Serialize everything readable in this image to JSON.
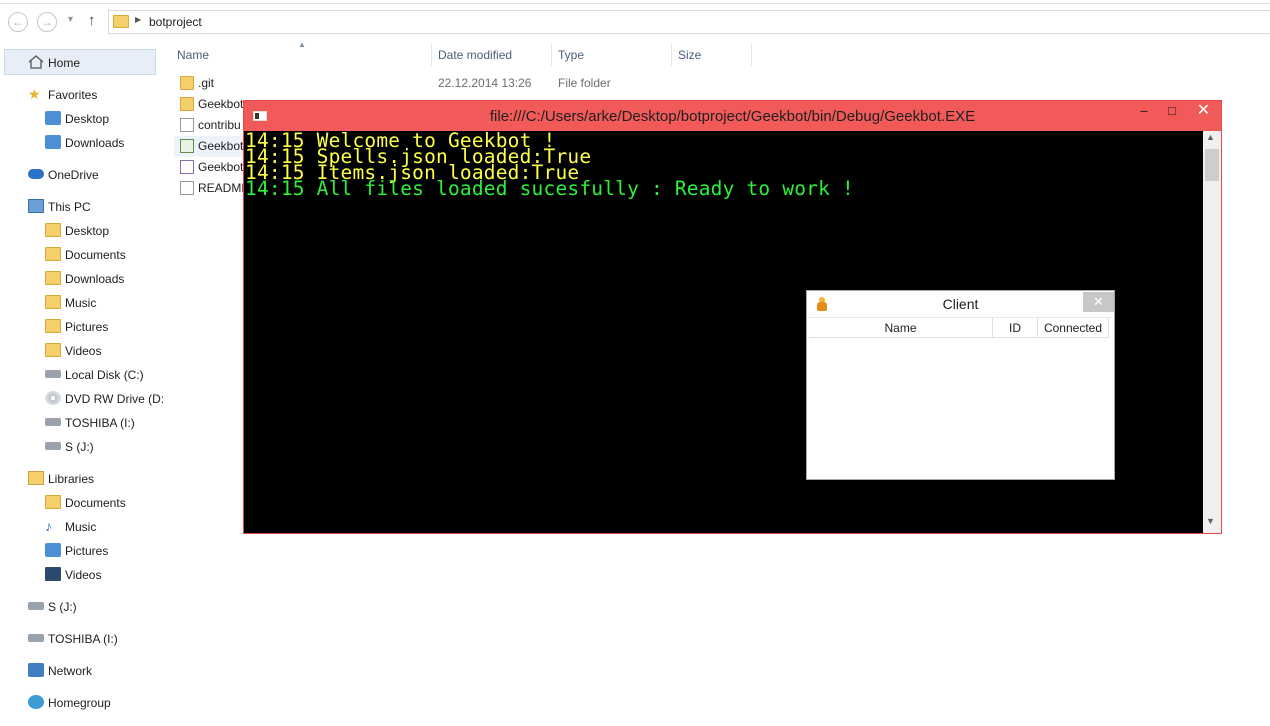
{
  "explorer": {
    "breadcrumb": "botproject",
    "columns": {
      "name": "Name",
      "date_modified": "Date modified",
      "type": "Type",
      "size": "Size"
    },
    "files": [
      {
        "name": ".git",
        "date": "22.12.2014 13:26",
        "type": "File folder",
        "icon": "folder-icon"
      },
      {
        "name": "Geekbot",
        "date": "",
        "type": "",
        "icon": "folder-icon"
      },
      {
        "name": "contribu",
        "date": "",
        "type": "",
        "icon": "file-icon"
      },
      {
        "name": "Geekbot",
        "date": "",
        "type": "",
        "icon": "solution-file-icon"
      },
      {
        "name": "Geekbot",
        "date": "",
        "type": "",
        "icon": "project-file-icon"
      },
      {
        "name": "README",
        "date": "",
        "type": "",
        "icon": "file-icon"
      }
    ]
  },
  "sidebar": {
    "home": "Home",
    "favorites": "Favorites",
    "fav_items": [
      "Desktop",
      "Downloads"
    ],
    "onedrive": "OneDrive",
    "this_pc": "This PC",
    "pc_items": [
      "Desktop",
      "Documents",
      "Downloads",
      "Music",
      "Pictures",
      "Videos",
      "Local Disk (C:)",
      "DVD RW Drive (D:",
      "TOSHIBA (I:)",
      "S (J:)"
    ],
    "libraries": "Libraries",
    "lib_items": [
      "Documents",
      "Music",
      "Pictures",
      "Videos"
    ],
    "s_drive": "S (J:)",
    "toshiba": "TOSHIBA (I:)",
    "network": "Network",
    "homegroup": "Homegroup"
  },
  "console": {
    "title": "file:///C:/Users/arke/Desktop/botproject/Geekbot/bin/Debug/Geekbot.EXE",
    "lines": [
      {
        "text": "14:15 Welcome to Geekbot !",
        "color": "#ffff46"
      },
      {
        "text": "14:15 Spells.json loaded:True",
        "color": "#ffff46"
      },
      {
        "text": "14:15 Items.json loaded:True",
        "color": "#ffff46"
      },
      {
        "text": "14:15 All files loaded sucesfully : Ready to work !",
        "color": "#2cf03a"
      }
    ],
    "minimize": "–",
    "maximize": "□",
    "close": "✕"
  },
  "client_window": {
    "title": "Client",
    "close": "✕",
    "columns": [
      "Name",
      "ID",
      "Connected"
    ]
  }
}
